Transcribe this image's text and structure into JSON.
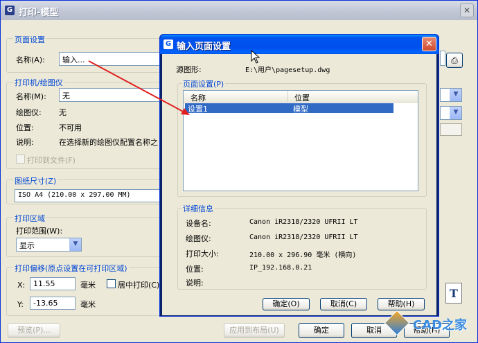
{
  "main": {
    "title": "打印-模型",
    "page_setup": {
      "section": "页面设置",
      "name_label": "名称(A):",
      "name_value": "输入..."
    },
    "printer": {
      "section": "打印机/绘图仪",
      "name_label": "名称(M):",
      "name_value": "无",
      "plotter_label": "绘图仪:",
      "plotter_value": "无",
      "location_label": "位置:",
      "location_value": "不可用",
      "desc_label": "说明:",
      "desc_value": "在选择新的绘图仪配置名称之",
      "print_to_file": "打印到文件(F)"
    },
    "paper": {
      "section": "图纸尺寸(Z)",
      "value": "ISO A4 (210.00 x 297.00 MM)"
    },
    "area": {
      "section": "打印区域",
      "range_label": "打印范围(W):",
      "range_value": "显示"
    },
    "offset": {
      "section": "打印偏移(原点设置在可打印区域)",
      "x_label": "X:",
      "x_value": "11.55",
      "y_label": "Y:",
      "y_value": "-13.65",
      "unit": "毫米",
      "center_label": "居中打印(C)"
    },
    "buttons": {
      "preview": "预览(P)...",
      "apply": "应用到布局(U)",
      "ok": "确定",
      "cancel": "取消",
      "help": "帮助(H)"
    }
  },
  "dialog": {
    "title": "输入页面设置",
    "source_label": "源图形:",
    "source_value": "E:\\用户\\pagesetup.dwg",
    "setups_section": "页面设置(P)",
    "columns": [
      "名称",
      "位置"
    ],
    "rows": [
      {
        "name": "设置1",
        "location": "模型"
      }
    ],
    "details_section": "详细信息",
    "details": [
      {
        "label": "设备名:",
        "value": "Canon iR2318/2320 UFRII LT"
      },
      {
        "label": "绘图仪:",
        "value": "Canon iR2318/2320 UFRII LT"
      },
      {
        "label": "打印大小:",
        "value": "210.00 x 296.90 毫米 (横向)"
      },
      {
        "label": "位置:",
        "value": "IP_192.168.0.21"
      },
      {
        "label": "说明:",
        "value": ""
      }
    ],
    "buttons": {
      "ok": "确定(O)",
      "cancel": "取消(C)",
      "help": "帮助(H)"
    }
  },
  "watermark": {
    "text": "CAD之家"
  },
  "colors": {
    "dialog_title": "#0053EE",
    "selection": "#316AC5",
    "annotation_arrow": "#E02020"
  }
}
